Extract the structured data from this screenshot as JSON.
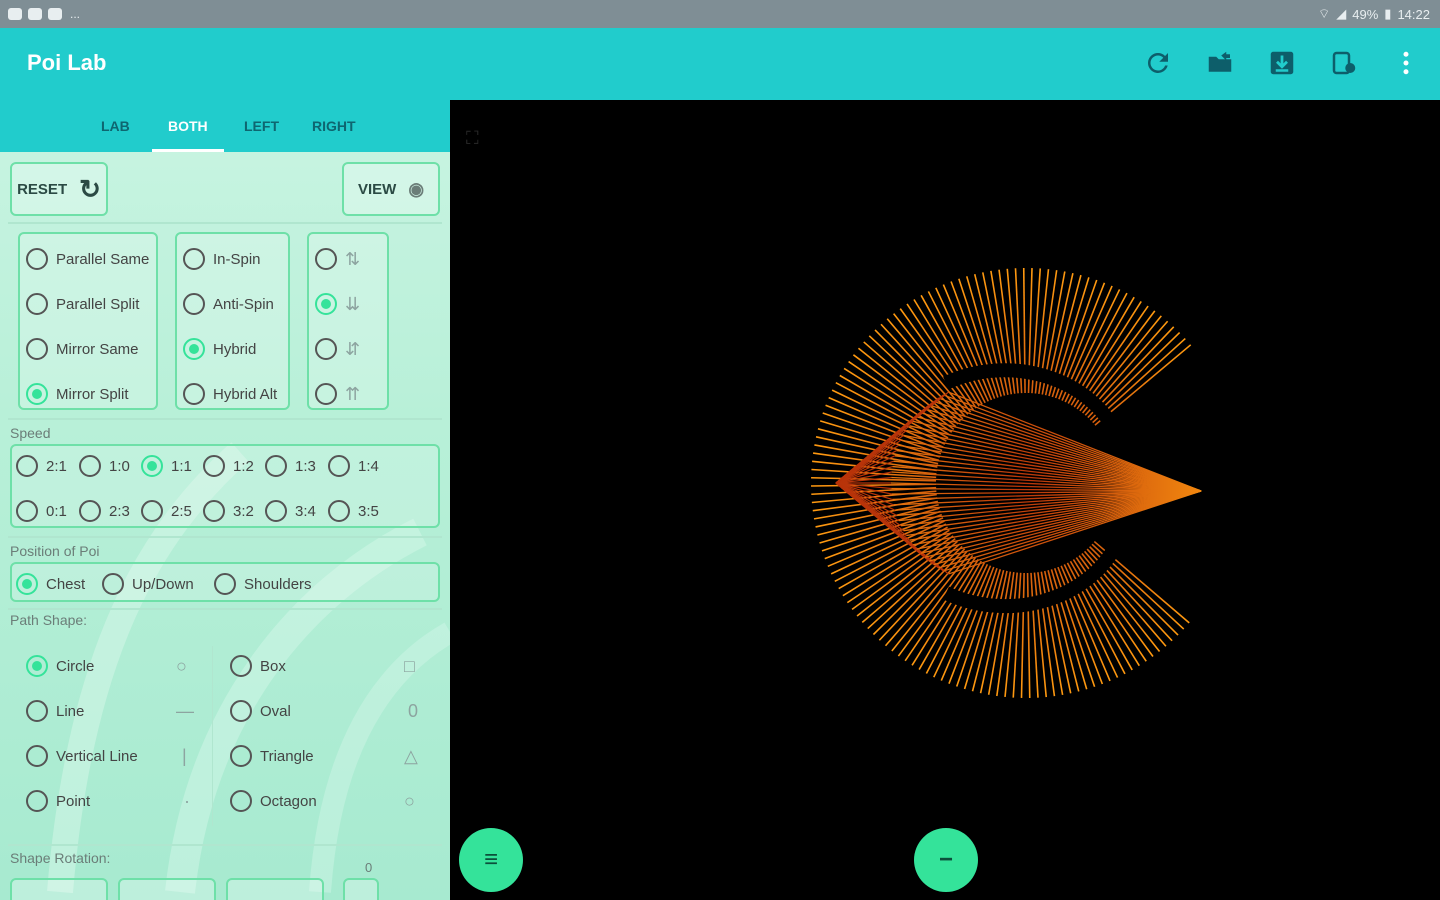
{
  "status_bar": {
    "battery": "49%",
    "time": "14:22",
    "more": "..."
  },
  "app": {
    "title": "Poi Lab"
  },
  "toolbar": {
    "icons": [
      "refresh-icon",
      "share-folder-icon",
      "download-icon",
      "copy-settings-icon",
      "overflow-menu-icon"
    ]
  },
  "tabs": [
    {
      "label": "LAB",
      "active": false
    },
    {
      "label": "BOTH",
      "active": true
    },
    {
      "label": "LEFT",
      "active": false
    },
    {
      "label": "RIGHT",
      "active": false
    }
  ],
  "buttons": {
    "reset": "RESET",
    "view": "VIEW"
  },
  "direction_options": [
    {
      "label": "Parallel Same",
      "selected": false
    },
    {
      "label": "Parallel Split",
      "selected": false
    },
    {
      "label": "Mirror Same",
      "selected": false
    },
    {
      "label": "Mirror Split",
      "selected": true
    }
  ],
  "spin_options": [
    {
      "label": "In-Spin",
      "selected": false
    },
    {
      "label": "Anti-Spin",
      "selected": false
    },
    {
      "label": "Hybrid",
      "selected": true
    },
    {
      "label": "Hybrid Alt",
      "selected": false
    }
  ],
  "phase_options": [
    {
      "selected": false
    },
    {
      "selected": true
    },
    {
      "selected": false
    },
    {
      "selected": false
    }
  ],
  "speed": {
    "label": "Speed",
    "options": [
      {
        "label": "2:1",
        "selected": false
      },
      {
        "label": "1:0",
        "selected": false
      },
      {
        "label": "1:1",
        "selected": true
      },
      {
        "label": "1:2",
        "selected": false
      },
      {
        "label": "1:3",
        "selected": false
      },
      {
        "label": "1:4",
        "selected": false
      },
      {
        "label": "0:1",
        "selected": false
      },
      {
        "label": "2:3",
        "selected": false
      },
      {
        "label": "2:5",
        "selected": false
      },
      {
        "label": "3:2",
        "selected": false
      },
      {
        "label": "3:4",
        "selected": false
      },
      {
        "label": "3:5",
        "selected": false
      }
    ]
  },
  "position": {
    "label": "Position of Poi",
    "options": [
      {
        "label": "Chest",
        "selected": true
      },
      {
        "label": "Up/Down",
        "selected": false
      },
      {
        "label": "Shoulders",
        "selected": false
      }
    ]
  },
  "path_shape": {
    "label": "Path Shape:",
    "left_options": [
      {
        "label": "Circle",
        "selected": true,
        "glyph": "○"
      },
      {
        "label": "Line",
        "selected": false,
        "glyph": "—"
      },
      {
        "label": "Vertical Line",
        "selected": false,
        "glyph": "|"
      },
      {
        "label": "Point",
        "selected": false,
        "glyph": "·"
      }
    ],
    "right_options": [
      {
        "label": "Box",
        "selected": false,
        "glyph": "□"
      },
      {
        "label": "Oval",
        "selected": false,
        "glyph": "0"
      },
      {
        "label": "Triangle",
        "selected": false,
        "glyph": "△"
      },
      {
        "label": "Octagon",
        "selected": false,
        "glyph": "○"
      }
    ]
  },
  "shape_rotation": {
    "label": "Shape Rotation:",
    "value": "0"
  },
  "canvas": {
    "color_inner": "#b8340a",
    "color_outer": "#ff9a10"
  },
  "fabs": {
    "menu": "≡",
    "minus": "−"
  }
}
